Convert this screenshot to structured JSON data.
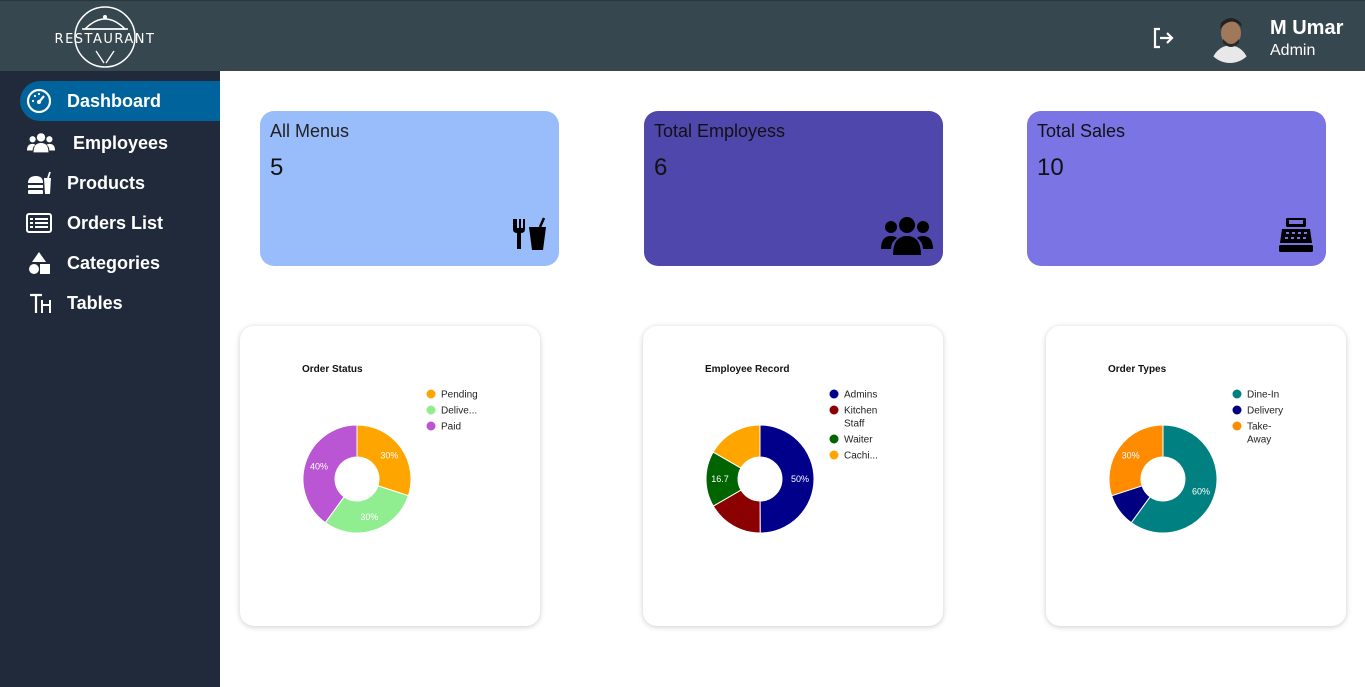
{
  "header": {
    "logo_text": "RESTAURANT",
    "user_name": "M Umar",
    "user_role": "Admin"
  },
  "sidebar": {
    "items": [
      {
        "label": "Dashboard",
        "icon": "gauge-icon",
        "active": true
      },
      {
        "label": "Employees",
        "icon": "users-icon",
        "active": false
      },
      {
        "label": "Products",
        "icon": "burger-drink-icon",
        "active": false
      },
      {
        "label": "Orders List",
        "icon": "list-icon",
        "active": false
      },
      {
        "label": "Categories",
        "icon": "shapes-icon",
        "active": false
      },
      {
        "label": "Tables",
        "icon": "table-icon",
        "active": false
      }
    ]
  },
  "stats": [
    {
      "title": "All Menus",
      "value": "5",
      "icon": "utensils-drink-icon",
      "color": "#99bcfb"
    },
    {
      "title": "Total Employess",
      "value": "6",
      "icon": "users-icon",
      "color": "#4f47ab"
    },
    {
      "title": "Total Sales",
      "value": "10",
      "icon": "cash-register-icon",
      "color": "#7a74e4"
    }
  ],
  "chart_data": [
    {
      "type": "pie",
      "title": "Order Status",
      "categories": [
        "Pending",
        "Delive...",
        "Paid"
      ],
      "values": [
        30,
        30,
        40
      ],
      "data_labels": [
        "30%",
        "30%",
        "40%"
      ],
      "colors": [
        "#ffa500",
        "#90ee90",
        "#ba55d3"
      ],
      "legend": "right"
    },
    {
      "type": "pie",
      "title": "Employee Record",
      "categories": [
        "Admins",
        "Kitchen Staff",
        "Waiter",
        "Cachi..."
      ],
      "values": [
        50,
        16.7,
        16.7,
        16.7
      ],
      "data_labels": [
        "50%",
        "",
        "16.7",
        ""
      ],
      "colors": [
        "#00008b",
        "#8b0000",
        "#006400",
        "#ffa500"
      ],
      "legend": "right"
    },
    {
      "type": "pie",
      "title": "Order Types",
      "categories": [
        "Dine-In",
        "Delivery",
        "Take-Away"
      ],
      "values": [
        60,
        10,
        30
      ],
      "data_labels": [
        "60%",
        "",
        "30%"
      ],
      "colors": [
        "#008080",
        "#000080",
        "#ff8c00"
      ],
      "legend": "right"
    }
  ]
}
